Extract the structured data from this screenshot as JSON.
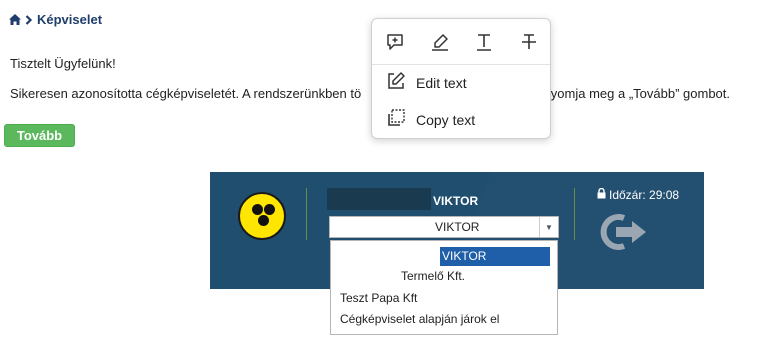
{
  "breadcrumb": {
    "icon": "home-icon",
    "separator_icon": "chevron-right-icon",
    "label": "Képviselet"
  },
  "content": {
    "greeting": "Tisztelt Ügyfelünk!",
    "message_start": "Sikeresen azonosította cégképviseletét. A rendszerünkben tö",
    "message_end": "oz nyomja meg a „Tovább” gombot.",
    "next_button": "Tovább"
  },
  "popup": {
    "tools": [
      "comment-add-icon",
      "highlighter-icon",
      "text-format-icon",
      "strikethrough-icon"
    ],
    "edit_text": "Edit text",
    "copy_text": "Copy text"
  },
  "header_bar": {
    "user_name": "VIKTOR",
    "timer_label": "Időzár: 29:08",
    "select_value": "VIKTOR",
    "options": [
      "VIKTOR",
      "Termelő Kft.",
      "Teszt Papa Kft",
      "Cégképviselet alapján járok el"
    ],
    "selected_option_index": 0
  },
  "colors": {
    "button_green": "#5cb85c",
    "bar_blue": "#1f4e6e",
    "select_highlight": "#1f5ea8",
    "logo_yellow": "#ffe600"
  }
}
